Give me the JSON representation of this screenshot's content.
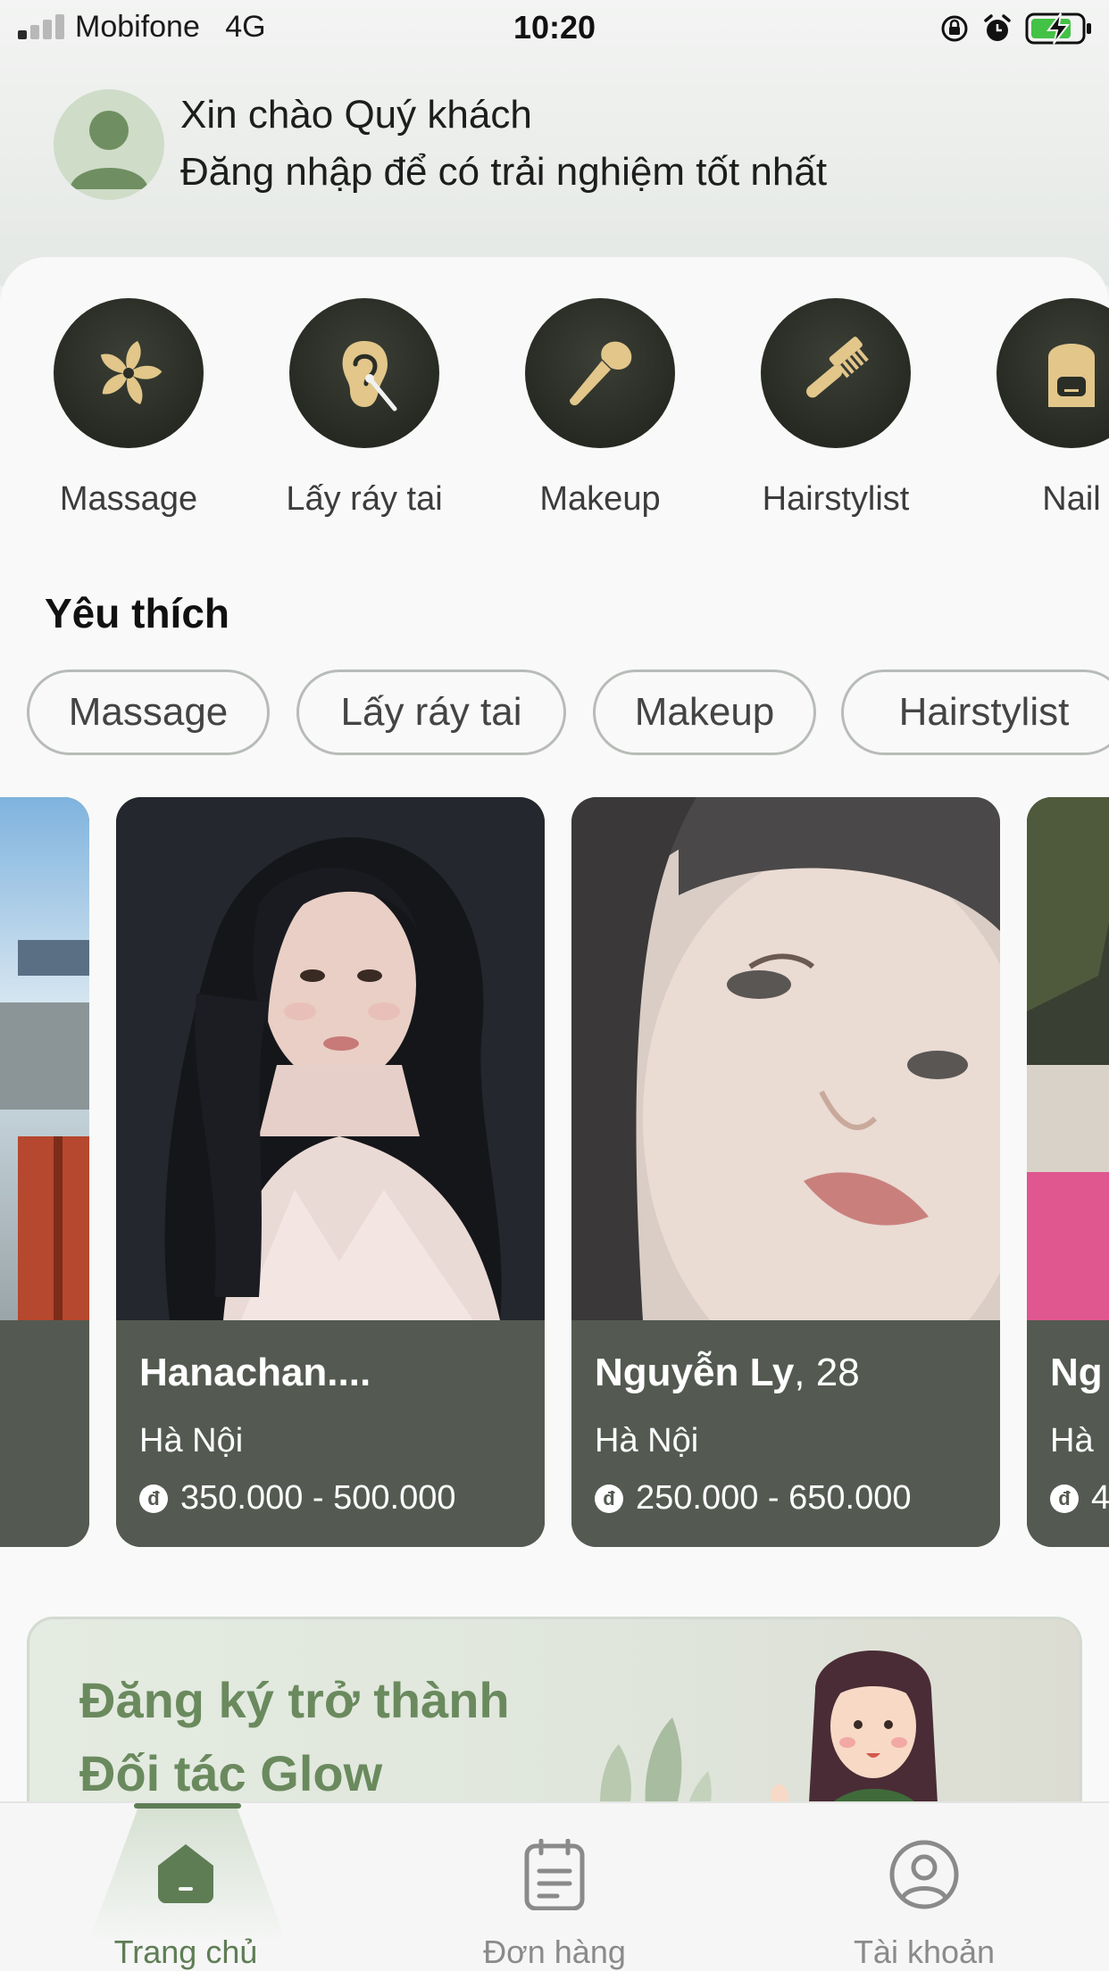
{
  "status_bar": {
    "carrier": "Mobifone",
    "network": "4G",
    "time": "10:20"
  },
  "header": {
    "greeting": "Xin chào Quý khách",
    "login_hint": "Đăng nhập để có trải nghiệm tốt nhất"
  },
  "categories": [
    {
      "label": "Massage",
      "icon": "flower-icon"
    },
    {
      "label": "Lấy ráy tai",
      "icon": "ear-icon"
    },
    {
      "label": "Makeup",
      "icon": "makeup-brush-icon"
    },
    {
      "label": "Hairstylist",
      "icon": "comb-icon"
    },
    {
      "label": "Nail",
      "icon": "nail-icon"
    }
  ],
  "favorites": {
    "title": "Yêu thích",
    "chips": [
      "Massage",
      "Lấy ráy tai",
      "Makeup",
      "Hairstylist"
    ]
  },
  "cards": [
    {
      "name": "Hanachan....",
      "age": "",
      "city": "Hà Nội",
      "price": "350.000 - 500.000"
    },
    {
      "name": "Nguyễn Ly",
      "age": ", 28",
      "city": "Hà Nội",
      "price": "250.000 - 650.000"
    },
    {
      "name": "Ng",
      "age": "",
      "city": "Hà",
      "price": "4"
    }
  ],
  "banner": {
    "line1": "Đăng ký trở thành",
    "line2": "Đối tác Glow"
  },
  "tabbar": {
    "items": [
      {
        "label": "Trang chủ",
        "icon": "home-icon",
        "active": true
      },
      {
        "label": "Đơn hàng",
        "icon": "orders-icon",
        "active": false
      },
      {
        "label": "Tài khoản",
        "icon": "account-icon",
        "active": false
      }
    ]
  },
  "colors": {
    "accent": "#5f7d55",
    "card_bg": "#545a51",
    "category_circle": "#262a22",
    "category_icon": "#e2c68a"
  }
}
